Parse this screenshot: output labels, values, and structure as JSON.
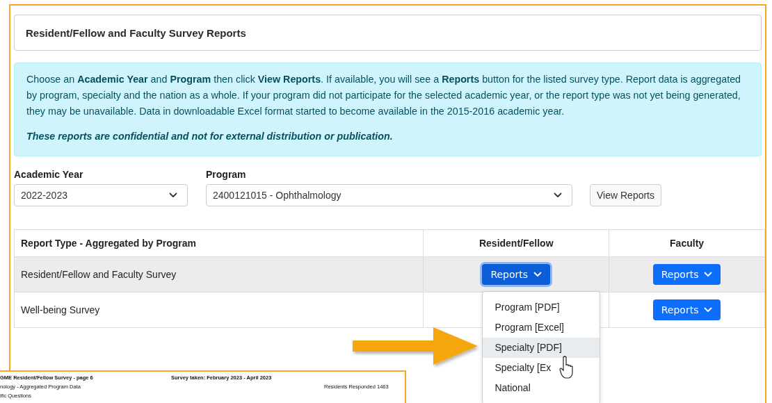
{
  "header": {
    "title": "Resident/Fellow and Faculty Survey Reports"
  },
  "notice": {
    "text": "Choose an **Academic Year** and **Program** then click **View Reports**. If available, you will see a **Reports** button for the listed survey type. Report data is aggregated by program, specialty and the nation as a whole. If your program did not participate for the selected academic year, or the report type was not yet being generated, they may be unavailable. Data in downloadable Excel format started to become available in the 2015-2016 academic year.",
    "warning": "These reports are confidential and not for external distribution or publication."
  },
  "filters": [
    {
      "label": "Academic Year",
      "value": "2022-2023"
    },
    {
      "label": "Program",
      "value": "2400121015 - Ophthalmology"
    }
  ],
  "view_button": "View Reports",
  "table": {
    "columns": [
      "Report Type - Aggregated by Program",
      "Resident/Fellow",
      "Faculty"
    ],
    "rows": [
      {
        "report_type": "Resident/Fellow and Faculty Survey",
        "resident_fellow": {
          "label": "Reports",
          "focused": true
        },
        "faculty": {
          "label": "Reports",
          "focused": false
        }
      },
      {
        "report_type": "Well-being Survey",
        "faculty": {
          "label": "Reports",
          "focused": false
        }
      }
    ]
  },
  "dropdown": {
    "items": [
      {
        "label": "Program [PDF]",
        "selected": false
      },
      {
        "label": "Program [Excel]",
        "selected": false
      },
      {
        "label": "Specialty [PDF]",
        "selected": true
      },
      {
        "label": "Specialty [Ex",
        "selected": false
      },
      {
        "label": "National",
        "selected": false
      }
    ]
  },
  "document_preview": {
    "title": "GME Resident/Fellow Survey - page 6",
    "survey_taken": "Survey taken: February 2023 - April 2023",
    "subtitle": "nology - Aggregated Program Data",
    "responded_label": "Residents Responded",
    "responded_count": "1463",
    "section": "ific Questions"
  }
}
